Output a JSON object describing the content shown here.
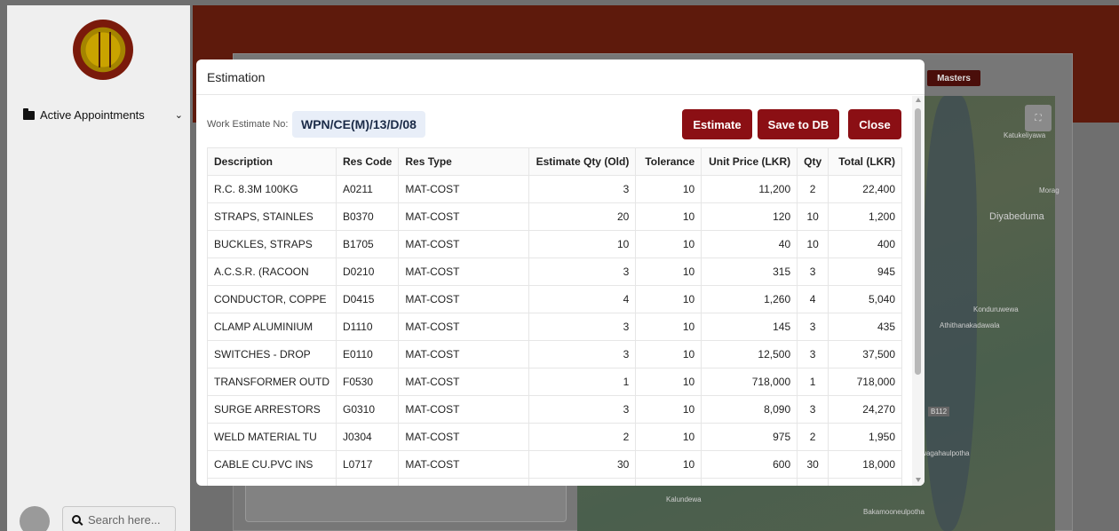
{
  "sidebar": {
    "active_appointments": "Active Appointments",
    "search_placeholder": "Search here..."
  },
  "masters_label": "Masters",
  "map_labels": [
    "Katukeliyawa",
    "Morag",
    "Diyabeduma",
    "Konduruwewa",
    "Athithanakadawala",
    "B112",
    "Awagahaulpotha",
    "Kalundewa",
    "Bakamooneulpotha"
  ],
  "modal": {
    "title": "Estimation",
    "work_estimate_label": "Work Estimate No:",
    "work_estimate_value": "WPN/CE(M)/13/D/08",
    "buttons": {
      "estimate": "Estimate",
      "save": "Save to DB",
      "close": "Close"
    },
    "columns": [
      "Description",
      "Res Code",
      "Res Type",
      "Estimate Qty (Old)",
      "Tolerance",
      "Unit Price (LKR)",
      "Qty",
      "Total (LKR)"
    ],
    "rows": [
      [
        "R.C. 8.3M 100KG",
        "A0211",
        "MAT-COST",
        "3",
        "10",
        "11,200",
        "2",
        "22,400"
      ],
      [
        "STRAPS, STAINLES",
        "B0370",
        "MAT-COST",
        "20",
        "10",
        "120",
        "10",
        "1,200"
      ],
      [
        "BUCKLES, STRAPS",
        "B1705",
        "MAT-COST",
        "10",
        "10",
        "40",
        "10",
        "400"
      ],
      [
        "A.C.S.R. (RACOON",
        "D0210",
        "MAT-COST",
        "3",
        "10",
        "315",
        "3",
        "945"
      ],
      [
        "CONDUCTOR, COPPE",
        "D0415",
        "MAT-COST",
        "4",
        "10",
        "1,260",
        "4",
        "5,040"
      ],
      [
        "CLAMP ALUMINIUM",
        "D1110",
        "MAT-COST",
        "3",
        "10",
        "145",
        "3",
        "435"
      ],
      [
        "SWITCHES - DROP",
        "E0110",
        "MAT-COST",
        "3",
        "10",
        "12,500",
        "3",
        "37,500"
      ],
      [
        "TRANSFORMER OUTD",
        "F0530",
        "MAT-COST",
        "1",
        "10",
        "718,000",
        "1",
        "718,000"
      ],
      [
        "SURGE ARRESTORS",
        "G0310",
        "MAT-COST",
        "3",
        "10",
        "8,090",
        "3",
        "24,270"
      ],
      [
        "WELD MATERIAL TU",
        "J0304",
        "MAT-COST",
        "2",
        "10",
        "975",
        "2",
        "1,950"
      ],
      [
        "CABLE CU.PVC INS",
        "L0717",
        "MAT-COST",
        "30",
        "10",
        "600",
        "30",
        "18,000"
      ]
    ]
  }
}
